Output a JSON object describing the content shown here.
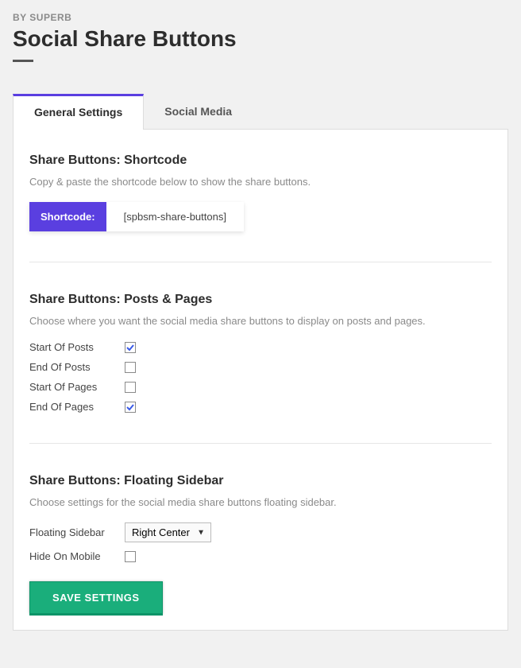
{
  "header": {
    "byline": "BY SUPERB",
    "title": "Social Share Buttons"
  },
  "tabs": {
    "general": "General Settings",
    "social": "Social Media"
  },
  "sections": {
    "shortcode": {
      "title": "Share Buttons: Shortcode",
      "desc": "Copy & paste the shortcode below to show the share buttons.",
      "badge_label": "Shortcode:",
      "value": "[spbsm-share-buttons]"
    },
    "posts_pages": {
      "title": "Share Buttons: Posts & Pages",
      "desc": "Choose where you want the social media share buttons to display on posts and pages.",
      "options": {
        "start_of_posts": "Start Of Posts",
        "end_of_posts": "End Of Posts",
        "start_of_pages": "Start Of Pages",
        "end_of_pages": "End Of Pages"
      }
    },
    "floating": {
      "title": "Share Buttons: Floating Sidebar",
      "desc": "Choose settings for the social media share buttons floating sidebar.",
      "floating_sidebar_label": "Floating Sidebar",
      "floating_sidebar_value": "Right Center",
      "hide_on_mobile_label": "Hide On Mobile"
    }
  },
  "footer": {
    "save_label": "SAVE SETTINGS"
  },
  "colors": {
    "accent": "#5a3fe0",
    "save_button": "#1aae7b"
  }
}
